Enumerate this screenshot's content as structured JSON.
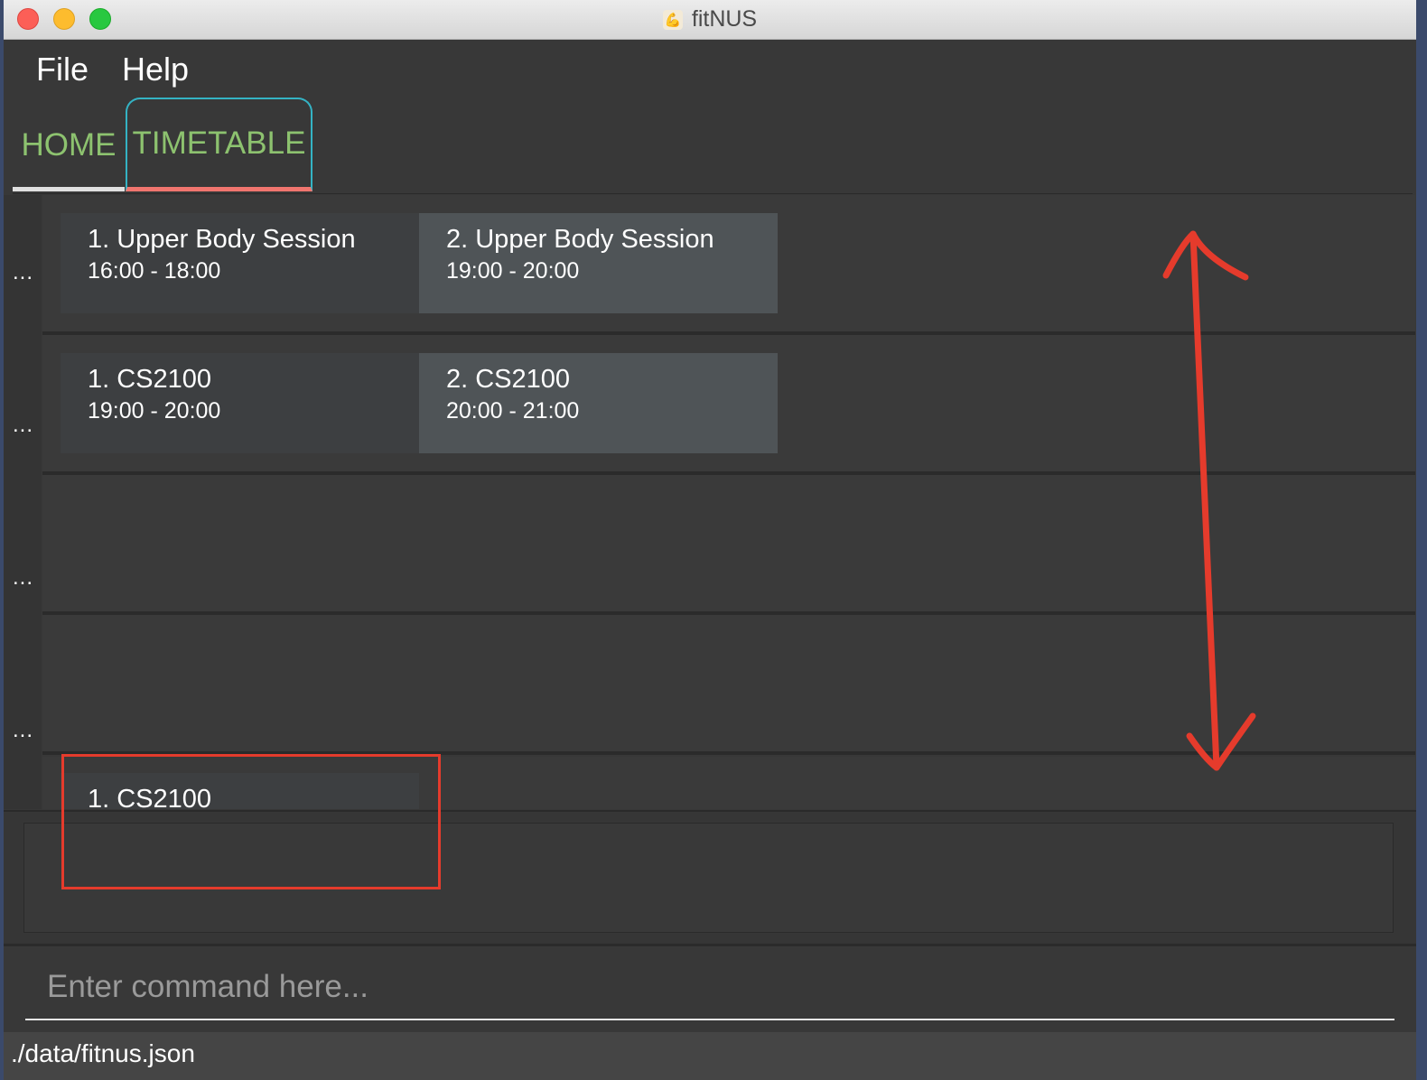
{
  "window": {
    "title": "fitNUS"
  },
  "menu": {
    "file": "File",
    "help": "Help"
  },
  "tabs": {
    "home": "HOME",
    "timetable": "TIMETABLE"
  },
  "rows": [
    {
      "ellipsis": "...",
      "slots": [
        {
          "label": "1.  Upper Body Session",
          "time": "16:00 - 18:00"
        },
        {
          "label": "2.  Upper Body Session",
          "time": "19:00 - 20:00"
        }
      ]
    },
    {
      "ellipsis": "...",
      "slots": [
        {
          "label": "1.  CS2100",
          "time": "19:00 - 20:00"
        },
        {
          "label": "2.  CS2100",
          "time": "20:00 - 21:00"
        }
      ]
    },
    {
      "ellipsis": "...",
      "slots": []
    },
    {
      "ellipsis": "...",
      "slots": []
    },
    {
      "slots": [
        {
          "label": "1.  CS2100"
        }
      ]
    }
  ],
  "command": {
    "placeholder": "Enter command here..."
  },
  "status": {
    "path": "./data/fitnus.json"
  },
  "colors": {
    "tab_text": "#8dc26f",
    "tab_active_border": "#34b3c4",
    "tab_active_underline": "#f0756e",
    "annotation": "#e53b2c"
  }
}
